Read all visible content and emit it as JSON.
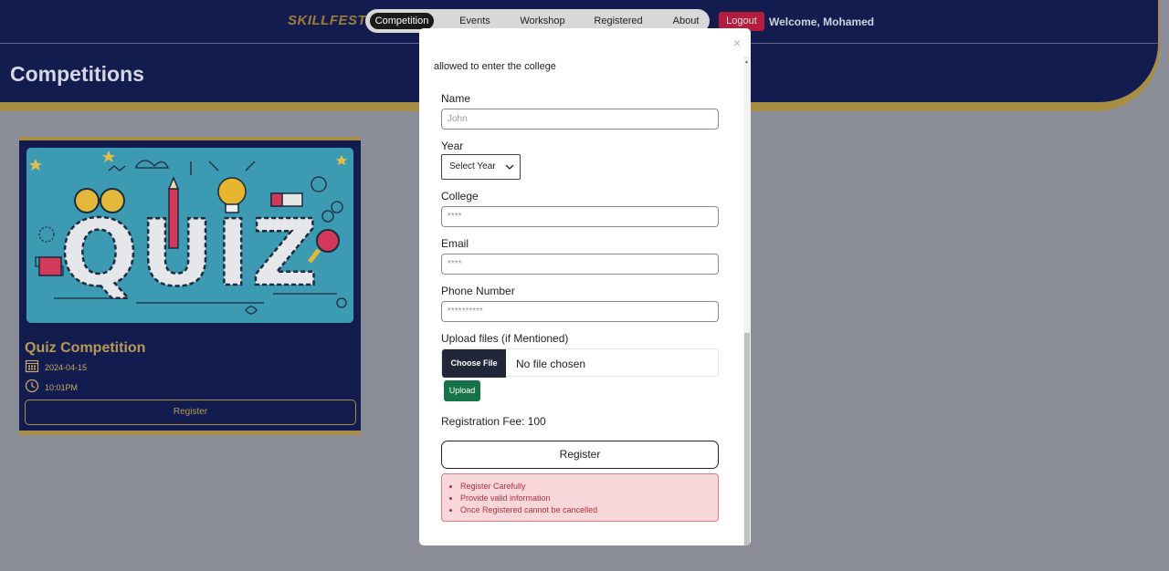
{
  "nav": {
    "brand": "SKILLFEST",
    "items": [
      {
        "label": "Competition",
        "active": true
      },
      {
        "label": "Events",
        "active": false
      },
      {
        "label": "Workshop",
        "active": false
      },
      {
        "label": "Registered",
        "active": false
      },
      {
        "label": "About",
        "active": false
      }
    ],
    "logout_label": "Logout",
    "welcome_text": "Welcome, Mohamed"
  },
  "page": {
    "title": "Competitions"
  },
  "card": {
    "image_word": "QUIZ",
    "title": "Quiz Competition",
    "date": "2024-04-15",
    "time": "10:01PM",
    "register_label": "Register"
  },
  "modal": {
    "close_symbol": "×",
    "notice_text": "allowed to enter the college",
    "fields": {
      "name_label": "Name",
      "name_placeholder": "John",
      "year_label": "Year",
      "year_selected": "Select Year",
      "college_label": "College",
      "college_placeholder": "****",
      "email_label": "Email",
      "email_placeholder": "****",
      "phone_label": "Phone Number",
      "phone_placeholder": "**********",
      "upload_label": "Upload files (if Mentioned)"
    },
    "file": {
      "button_label": "Choose File",
      "status": "No file chosen"
    },
    "upload_button": "Upload",
    "fee_text": "Registration Fee: 100",
    "register_label": "Register",
    "alerts": [
      "Register Carefully",
      "Provide valid information",
      "Once Registered cannot be cancelled"
    ]
  },
  "colors": {
    "navy": "#131c4e",
    "gold": "#a88d45",
    "logout": "#b31e3e",
    "upload": "#157347",
    "alert_bg": "#f8d7da",
    "alert_text": "#b0303e"
  }
}
